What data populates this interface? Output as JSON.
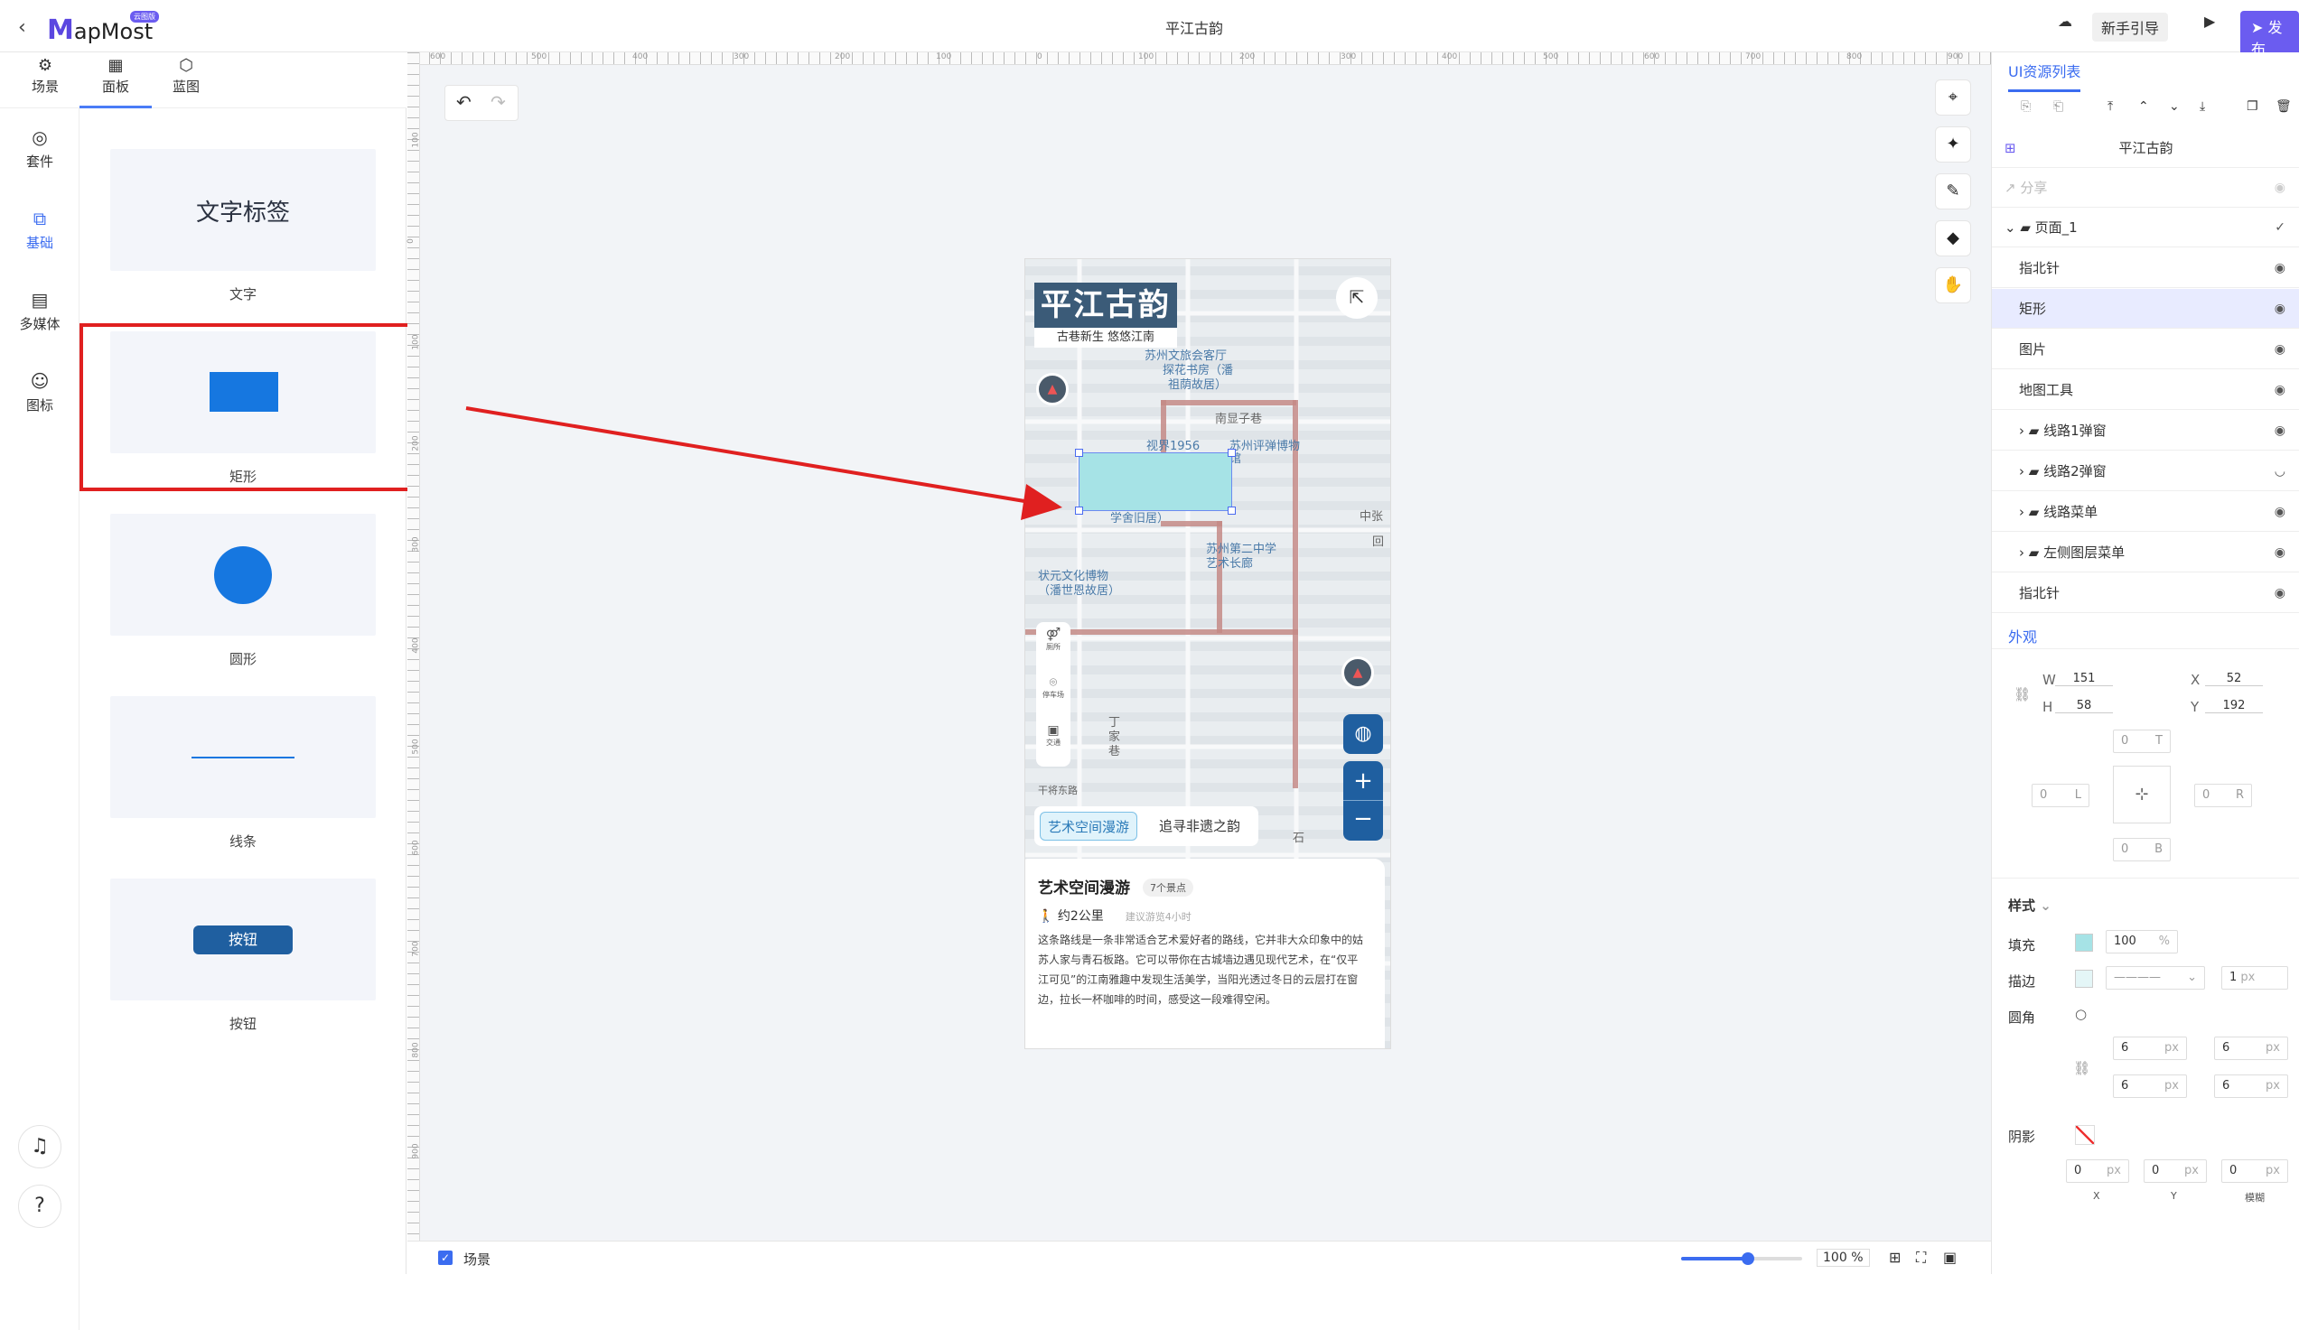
{
  "topbar": {
    "logo_m": "M",
    "logo_text": "apMost",
    "logo_badge": "云图版",
    "doc_title": "平江古韵",
    "guide_label": "新手引导",
    "publish_label": "发布"
  },
  "left_tabs": [
    {
      "label": "场景"
    },
    {
      "label": "面板"
    },
    {
      "label": "蓝图"
    }
  ],
  "left_nav": [
    {
      "label": "套件"
    },
    {
      "label": "基础"
    },
    {
      "label": "多媒体"
    },
    {
      "label": "图标"
    }
  ],
  "components": [
    {
      "label": "文字",
      "preview_text": "文字标签"
    },
    {
      "label": "矩形"
    },
    {
      "label": "圆形"
    },
    {
      "label": "线条"
    },
    {
      "label": "按钮",
      "preview_text": "按钮"
    }
  ],
  "ruler_h": [
    "600",
    "500",
    "400",
    "300",
    "200",
    "100",
    "0",
    "100",
    "200",
    "300",
    "400",
    "500",
    "600",
    "700",
    "800",
    "900"
  ],
  "ruler_v": [
    "100",
    "0",
    "100",
    "200",
    "300",
    "400",
    "500",
    "600",
    "700",
    "800",
    "900"
  ],
  "map": {
    "title": "平江古韵",
    "subtitle": "古巷新生  悠悠江南",
    "labels": [
      "苏州文旅会客厅",
      "探花书房（潘",
      "祖荫故居）",
      "南显子巷",
      "视界1956",
      "苏州评弹博物",
      "馆",
      "学舍旧居）",
      "中张",
      "回",
      "状元文化博物",
      "（潘世恩故居）",
      "苏州第二中学",
      "艺术长廊",
      "丁",
      "家",
      "巷",
      "干将东路",
      "石"
    ],
    "side_tools": [
      "厕所",
      "停车场",
      "交通"
    ],
    "route_tabs": [
      "艺术空间漫游",
      "追寻非遗之韵"
    ],
    "info": {
      "title": "艺术空间漫游",
      "badge": "7个景点",
      "distance": "约2公里",
      "hint": "建议游览4小时",
      "desc": "这条路线是一条非常适合艺术爱好者的路线，它并非大众印象中的姑苏人家与青石板路。它可以带你在古城墙边遇见现代艺术，在“仅平江可见”的江南雅趣中发现生活美学，当阳光透过冬日的云层打在窗边，拉长一杯咖啡的时间，感受这一段难得空闲。"
    }
  },
  "bottombar": {
    "scene_label": "场景",
    "zoom": "100",
    "zoom_unit": "%",
    "zoom_fraction": 0.55
  },
  "right_panel": {
    "header": "UI资源列表",
    "project": "平江古韵",
    "share_label": "分享",
    "tree": [
      {
        "label": "页面_1",
        "level": 0,
        "type": "folder",
        "mark": "✓"
      },
      {
        "label": "指北针",
        "level": 1,
        "type": "leaf",
        "mark": "◉"
      },
      {
        "label": "矩形",
        "level": 1,
        "type": "leaf",
        "mark": "◉",
        "selected": true
      },
      {
        "label": "图片",
        "level": 1,
        "type": "leaf",
        "mark": "◉"
      },
      {
        "label": "地图工具",
        "level": 1,
        "type": "leaf",
        "mark": "◉"
      },
      {
        "label": "线路1弹窗",
        "level": 1,
        "type": "folder",
        "mark": "◉"
      },
      {
        "label": "线路2弹窗",
        "level": 1,
        "type": "folder",
        "mark": "◡"
      },
      {
        "label": "线路菜单",
        "level": 1,
        "type": "folder",
        "mark": "◉"
      },
      {
        "label": "左侧图层菜单",
        "level": 1,
        "type": "folder",
        "mark": "◉"
      },
      {
        "label": "指北针",
        "level": 1,
        "type": "leaf",
        "mark": "◉"
      }
    ],
    "appearance_tab": "外观",
    "W_label": "W",
    "W": "151",
    "H_label": "H",
    "H": "58",
    "X_label": "X",
    "X": "52",
    "Y_label": "Y",
    "Y": "192",
    "margin": {
      "T": "T",
      "L": "L",
      "R": "R",
      "B": "B",
      "value": "0"
    },
    "style_title": "样式",
    "fill_label": "填充",
    "fill_color": "#a6e3e6",
    "fill_opacity": "100",
    "fill_unit": "%",
    "stroke_label": "描边",
    "stroke_width": "1",
    "stroke_unit": "px",
    "radius_label": "圆角",
    "radius_values": [
      "6",
      "6",
      "6",
      "6"
    ],
    "radius_unit": "px",
    "shadow_label": "阴影",
    "shadow_values": [
      "0",
      "0",
      "0"
    ],
    "shadow_unit": "px",
    "shadow_axes": [
      "X",
      "Y",
      "模糊"
    ]
  }
}
